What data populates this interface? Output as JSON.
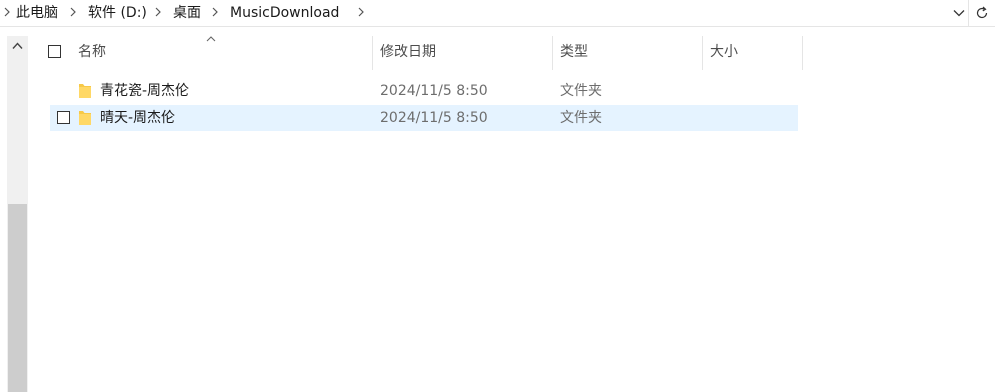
{
  "breadcrumb": {
    "items": [
      "此电脑",
      "软件 (D:)",
      "桌面",
      "MusicDownload"
    ]
  },
  "columns": {
    "name": "名称",
    "modified": "修改日期",
    "type": "类型",
    "size": "大小"
  },
  "files": [
    {
      "name": "青花瓷-周杰伦",
      "modified": "2024/11/5 8:50",
      "type": "文件夹",
      "size": ""
    },
    {
      "name": "晴天-周杰伦",
      "modified": "2024/11/5 8:50",
      "type": "文件夹",
      "size": ""
    }
  ],
  "colors": {
    "selected_row": "#e5f3ff",
    "folder": "#f7c948",
    "scroll_thumb": "#cdcdcd"
  },
  "icons": [
    "chevron-right-icon",
    "chevron-down-icon",
    "refresh-icon",
    "scroll-up-icon",
    "sort-up-icon",
    "folder-icon"
  ]
}
